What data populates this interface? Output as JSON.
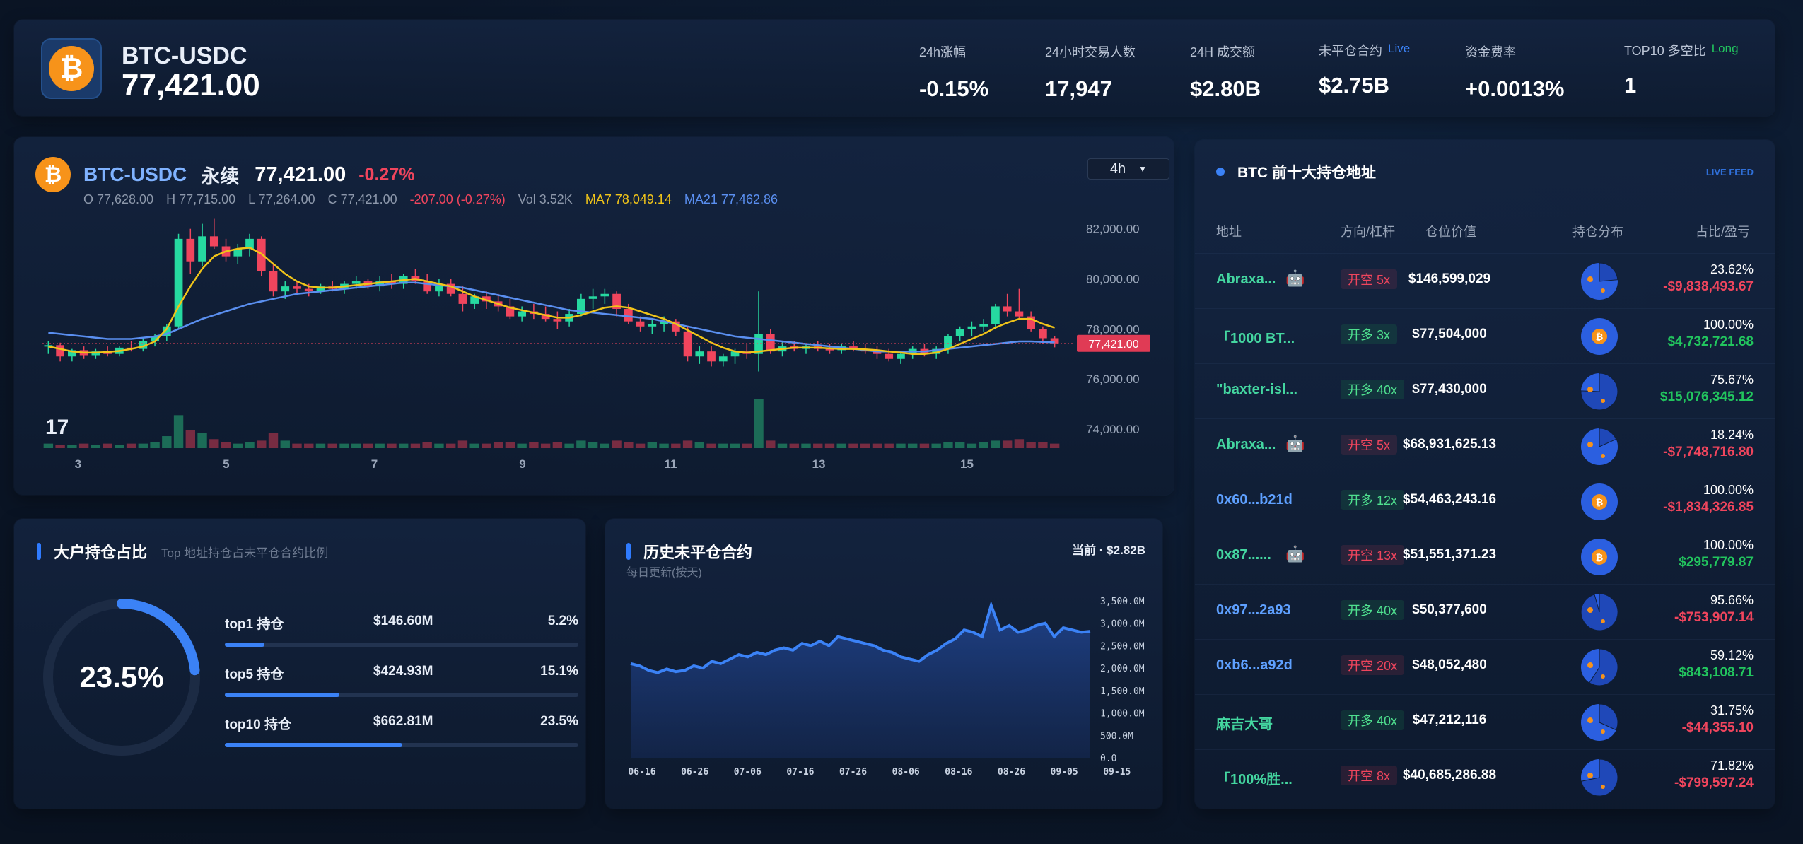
{
  "header": {
    "pair": "BTC-USDC",
    "price": "77,421.00",
    "stats": [
      {
        "label": "24h涨幅",
        "value": "-0.15%",
        "tone": "neg",
        "live": ""
      },
      {
        "label": "24小时交易人数",
        "value": "17,947",
        "tone": "",
        "live": ""
      },
      {
        "label": "24H 成交额",
        "value": "$2.80B",
        "tone": "",
        "live": ""
      },
      {
        "label": "未平仓合约",
        "value": "$2.75B",
        "tone": "",
        "live": "Live"
      },
      {
        "label": "资金费率",
        "value": "+0.0013%",
        "tone": "pos",
        "live": ""
      },
      {
        "label": "TOP10 多空比",
        "value": "1",
        "tone": "",
        "live": "Long"
      }
    ]
  },
  "chart": {
    "name": "BTC-USDC",
    "perp": "永续",
    "price": "77,421.00",
    "change": "-0.27%",
    "interval": "4h",
    "ohlc": {
      "open": "O 77,628.00",
      "high": "H 77,715.00",
      "low": "L 77,264.00",
      "close": "C 77,421.00",
      "delta": "-207.00 (-0.27%)",
      "vol": "Vol 3.52K",
      "ma7": "MA7 78,049.14",
      "ma21": "MA21 77,462.86"
    },
    "price_tag": "77,421.00",
    "colors": {
      "up": "#26d9a0",
      "down": "#f0455d",
      "ma7": "#f0c419",
      "ma21": "#5a8ff0"
    }
  },
  "chart_data": [
    {
      "type": "candlestick",
      "title": "BTC-USDC",
      "x_ticks": [
        "3",
        "5",
        "7",
        "9",
        "11",
        "13",
        "15"
      ],
      "y_ticks": [
        "82,000.00",
        "80,000.00",
        "78,000.00",
        "76,000.00",
        "74,000.00"
      ],
      "ylim": [
        73800,
        82500
      ],
      "ohlc": [
        [
          77300,
          77500,
          77000,
          77350
        ],
        [
          77350,
          77450,
          76700,
          76900
        ],
        [
          76900,
          77200,
          76700,
          77150
        ],
        [
          77150,
          77300,
          76800,
          76950
        ],
        [
          76950,
          77200,
          76800,
          77100
        ],
        [
          77100,
          77300,
          76900,
          77000
        ],
        [
          77000,
          77300,
          76900,
          77250
        ],
        [
          77250,
          77500,
          77100,
          77200
        ],
        [
          77200,
          77600,
          77100,
          77500
        ],
        [
          77500,
          77800,
          77300,
          77700
        ],
        [
          77700,
          78200,
          77500,
          78100
        ],
        [
          78100,
          81800,
          78000,
          81600
        ],
        [
          81600,
          82000,
          80200,
          80700
        ],
        [
          80700,
          82200,
          80500,
          81700
        ],
        [
          81700,
          82400,
          81200,
          81300
        ],
        [
          81300,
          81600,
          80700,
          80900
        ],
        [
          80900,
          81400,
          80600,
          81200
        ],
        [
          81200,
          81800,
          80900,
          81600
        ],
        [
          81600,
          81700,
          80100,
          80300
        ],
        [
          80300,
          80600,
          79300,
          79500
        ],
        [
          79500,
          79900,
          79200,
          79700
        ],
        [
          79700,
          79900,
          79400,
          79600
        ],
        [
          79600,
          79800,
          79300,
          79500
        ],
        [
          79500,
          79800,
          79400,
          79700
        ],
        [
          79700,
          79900,
          79500,
          79600
        ],
        [
          79600,
          79900,
          79400,
          79800
        ],
        [
          79800,
          80100,
          79600,
          79900
        ],
        [
          79900,
          80000,
          79600,
          79700
        ],
        [
          79700,
          80100,
          79500,
          79900
        ],
        [
          79900,
          80200,
          79600,
          79800
        ],
        [
          79800,
          80200,
          79600,
          80100
        ],
        [
          80100,
          80400,
          79800,
          79900
        ],
        [
          79900,
          80200,
          79400,
          79500
        ],
        [
          79500,
          80000,
          79300,
          79800
        ],
        [
          79800,
          80000,
          79300,
          79400
        ],
        [
          79400,
          79700,
          78700,
          79000
        ],
        [
          79000,
          79400,
          78800,
          79300
        ],
        [
          79300,
          79500,
          78800,
          79100
        ],
        [
          79100,
          79400,
          78700,
          78900
        ],
        [
          78900,
          79200,
          78400,
          78500
        ],
        [
          78500,
          78900,
          78300,
          78700
        ],
        [
          78700,
          79000,
          78400,
          78600
        ],
        [
          78600,
          78900,
          78300,
          78400
        ],
        [
          78400,
          78700,
          78000,
          78300
        ],
        [
          78300,
          78800,
          78100,
          78600
        ],
        [
          78600,
          79400,
          78500,
          79200
        ],
        [
          79200,
          79600,
          78800,
          79300
        ],
        [
          79300,
          79600,
          79000,
          79400
        ],
        [
          79400,
          79500,
          78500,
          78800
        ],
        [
          78800,
          79000,
          78200,
          78300
        ],
        [
          78300,
          78500,
          77900,
          78100
        ],
        [
          78100,
          78400,
          77800,
          78200
        ],
        [
          78200,
          78500,
          77900,
          78300
        ],
        [
          78300,
          78400,
          77700,
          77900
        ],
        [
          77900,
          78100,
          76700,
          76900
        ],
        [
          76900,
          77300,
          76600,
          77100
        ],
        [
          77100,
          77300,
          76500,
          76700
        ],
        [
          76700,
          77000,
          76500,
          76900
        ],
        [
          76900,
          77200,
          76600,
          77100
        ],
        [
          77100,
          77400,
          76800,
          77000
        ],
        [
          77000,
          79500,
          76300,
          77800
        ],
        [
          77800,
          78000,
          77000,
          77100
        ],
        [
          77100,
          77500,
          76900,
          77300
        ],
        [
          77300,
          77500,
          77100,
          77200
        ],
        [
          77200,
          77400,
          77000,
          77300
        ],
        [
          77300,
          77500,
          77100,
          77200
        ],
        [
          77200,
          77400,
          77000,
          77150
        ],
        [
          77150,
          77400,
          77000,
          77300
        ],
        [
          77300,
          77500,
          77100,
          77200
        ],
        [
          77200,
          77400,
          77000,
          77100
        ],
        [
          77100,
          77300,
          76800,
          77000
        ],
        [
          77000,
          77200,
          76700,
          76800
        ],
        [
          76800,
          77100,
          76600,
          77000
        ],
        [
          77000,
          77300,
          76800,
          77200
        ],
        [
          77200,
          77400,
          76900,
          77000
        ],
        [
          77000,
          77300,
          76800,
          77200
        ],
        [
          77200,
          77800,
          77000,
          77700
        ],
        [
          77700,
          78100,
          77500,
          78000
        ],
        [
          78000,
          78300,
          77700,
          78100
        ],
        [
          78100,
          78400,
          77900,
          78200
        ],
        [
          78200,
          79000,
          78000,
          78900
        ],
        [
          78900,
          79400,
          78500,
          78700
        ],
        [
          78700,
          79600,
          78400,
          78500
        ],
        [
          78500,
          78700,
          77900,
          78000
        ],
        [
          78000,
          78100,
          77400,
          77628
        ],
        [
          77628,
          77715,
          77264,
          77421
        ]
      ],
      "ma7": [
        77300,
        77200,
        77100,
        77050,
        77050,
        77080,
        77120,
        77200,
        77300,
        77500,
        78000,
        78900,
        79700,
        80400,
        80900,
        81100,
        81200,
        81250,
        81000,
        80600,
        80200,
        79900,
        79700,
        79650,
        79650,
        79700,
        79750,
        79800,
        79850,
        79900,
        79950,
        80000,
        79900,
        79800,
        79700,
        79500,
        79300,
        79150,
        79000,
        78850,
        78750,
        78650,
        78550,
        78450,
        78450,
        78550,
        78700,
        78850,
        78900,
        78850,
        78700,
        78550,
        78400,
        78200,
        77950,
        77700,
        77450,
        77250,
        77100,
        77050,
        77100,
        77150,
        77200,
        77250,
        77250,
        77250,
        77220,
        77200,
        77200,
        77180,
        77150,
        77100,
        77050,
        77000,
        77000,
        77050,
        77200,
        77400,
        77600,
        77800,
        78050,
        78250,
        78400,
        78400,
        78200,
        78049
      ],
      "ma21": [
        77850,
        77800,
        77750,
        77700,
        77650,
        77600,
        77600,
        77600,
        77650,
        77700,
        77800,
        78000,
        78200,
        78400,
        78550,
        78700,
        78850,
        79000,
        79100,
        79200,
        79300,
        79400,
        79450,
        79500,
        79550,
        79600,
        79650,
        79700,
        79750,
        79800,
        79850,
        79850,
        79800,
        79750,
        79700,
        79650,
        79550,
        79450,
        79350,
        79250,
        79150,
        79050,
        78950,
        78850,
        78750,
        78700,
        78650,
        78600,
        78550,
        78500,
        78450,
        78400,
        78300,
        78200,
        78100,
        78000,
        77900,
        77800,
        77700,
        77650,
        77600,
        77550,
        77500,
        77450,
        77400,
        77350,
        77300,
        77250,
        77200,
        77150,
        77100,
        77100,
        77100,
        77100,
        77100,
        77150,
        77200,
        77250,
        77300,
        77350,
        77400,
        77450,
        77500,
        77500,
        77480,
        77462
      ],
      "volume": [
        3,
        2,
        2,
        3,
        2,
        3,
        2,
        3,
        3,
        4,
        8,
        22,
        12,
        10,
        6,
        4,
        3,
        4,
        5,
        10,
        5,
        3,
        3,
        3,
        3,
        3,
        3,
        3,
        3,
        3,
        3,
        3,
        4,
        3,
        3,
        5,
        3,
        3,
        4,
        4,
        3,
        4,
        3,
        4,
        3,
        5,
        4,
        3,
        5,
        4,
        3,
        4,
        3,
        3,
        5,
        4,
        3,
        3,
        3,
        3,
        33,
        5,
        3,
        3,
        3,
        3,
        3,
        3,
        3,
        3,
        3,
        3,
        3,
        3,
        3,
        3,
        4,
        4,
        3,
        4,
        5,
        5,
        6,
        4,
        4,
        3
      ]
    },
    {
      "type": "area",
      "title": "历史未平仓合约",
      "x_ticks": [
        "06-16",
        "06-26",
        "07-06",
        "07-16",
        "07-26",
        "08-06",
        "08-16",
        "08-26",
        "09-05",
        "09-15"
      ],
      "y_ticks": [
        "3,500.0M",
        "3,000.0M",
        "2,500.0M",
        "2,000.0M",
        "1,500.0M",
        "1,000.0M",
        "500.0M",
        "0.0"
      ],
      "ylim": [
        0,
        3500
      ],
      "unit": "M",
      "values": [
        2100,
        2050,
        1950,
        1900,
        1980,
        1920,
        1950,
        2050,
        2000,
        2150,
        2100,
        2200,
        2300,
        2250,
        2350,
        2300,
        2400,
        2450,
        2400,
        2550,
        2500,
        2600,
        2500,
        2700,
        2650,
        2600,
        2550,
        2500,
        2400,
        2350,
        2250,
        2200,
        2150,
        2300,
        2400,
        2550,
        2650,
        2850,
        2800,
        2700,
        3400,
        2850,
        2950,
        2800,
        2850,
        2950,
        3000,
        2700,
        2900,
        2850,
        2800,
        2820
      ]
    }
  ],
  "ratio": {
    "title": "大户持仓占比",
    "subtitle": "Top 地址持仓占未平仓合约比例",
    "percent": "23.5%",
    "percent_value": 23.5,
    "tiers": [
      {
        "label": "top1 持仓",
        "amount": "$146.60M",
        "pct": "5.2%",
        "fraction": 0.052
      },
      {
        "label": "top5 持仓",
        "amount": "$424.93M",
        "pct": "15.1%",
        "fraction": 0.151
      },
      {
        "label": "top10 持仓",
        "amount": "$662.81M",
        "pct": "23.5%",
        "fraction": 0.235
      }
    ]
  },
  "oi": {
    "title": "历史未平仓合约",
    "subtitle": "每日更新(按天)",
    "current": "当前 · $2.82B"
  },
  "holders": {
    "title": "BTC 前十大持仓地址",
    "live": "LIVE FEED",
    "columns": [
      "地址",
      "方向/杠杆",
      "仓位价值",
      "持仓分布",
      "占比/盈亏"
    ],
    "rows": [
      {
        "addr": "Abraxa...",
        "robot": true,
        "color": "green",
        "side": "开空 5x",
        "dir": "short",
        "value": "$146,599,029",
        "pct": "23.62%",
        "pnl": "-$9,838,493.67",
        "pnl_tone": "neg",
        "share": 0.2362
      },
      {
        "addr": "「1000 BT...",
        "robot": false,
        "color": "green",
        "side": "开多 3x",
        "dir": "long",
        "value": "$77,504,000",
        "pct": "100.00%",
        "pnl": "$4,732,721.68",
        "pnl_tone": "pos",
        "share": 1.0
      },
      {
        "addr": "\"baxter-isl...",
        "robot": false,
        "color": "green",
        "side": "开多 40x",
        "dir": "long",
        "value": "$77,430,000",
        "pct": "75.67%",
        "pnl": "$15,076,345.12",
        "pnl_tone": "pos",
        "share": 0.7567
      },
      {
        "addr": "Abraxa...",
        "robot": true,
        "color": "green",
        "side": "开空 5x",
        "dir": "short",
        "value": "$68,931,625.13",
        "pct": "18.24%",
        "pnl": "-$7,748,716.80",
        "pnl_tone": "neg",
        "share": 0.1824
      },
      {
        "addr": "0x60...b21d",
        "robot": false,
        "color": "blue",
        "side": "开多 12x",
        "dir": "long",
        "value": "$54,463,243.16",
        "pct": "100.00%",
        "pnl": "-$1,834,326.85",
        "pnl_tone": "neg",
        "share": 1.0
      },
      {
        "addr": "0x87......",
        "robot": true,
        "color": "green",
        "side": "开空 13x",
        "dir": "short",
        "value": "$51,551,371.23",
        "pct": "100.00%",
        "pnl": "$295,779.87",
        "pnl_tone": "pos",
        "share": 1.0
      },
      {
        "addr": "0x97...2a93",
        "robot": false,
        "color": "blue",
        "side": "开多 40x",
        "dir": "long",
        "value": "$50,377,600",
        "pct": "95.66%",
        "pnl": "-$753,907.14",
        "pnl_tone": "neg",
        "share": 0.9566
      },
      {
        "addr": "0xb6...a92d",
        "robot": false,
        "color": "blue",
        "side": "开空 20x",
        "dir": "short",
        "value": "$48,052,480",
        "pct": "59.12%",
        "pnl": "$843,108.71",
        "pnl_tone": "pos",
        "share": 0.5912
      },
      {
        "addr": "麻吉大哥",
        "robot": false,
        "color": "green",
        "side": "开多 40x",
        "dir": "long",
        "value": "$47,212,116",
        "pct": "31.75%",
        "pnl": "-$44,355.10",
        "pnl_tone": "neg",
        "share": 0.3175
      },
      {
        "addr": "「100%胜...",
        "robot": false,
        "color": "green",
        "side": "开空 8x",
        "dir": "short",
        "value": "$40,685,286.88",
        "pct": "71.82%",
        "pnl": "-$799,597.24",
        "pnl_tone": "neg",
        "share": 0.7182
      }
    ]
  }
}
